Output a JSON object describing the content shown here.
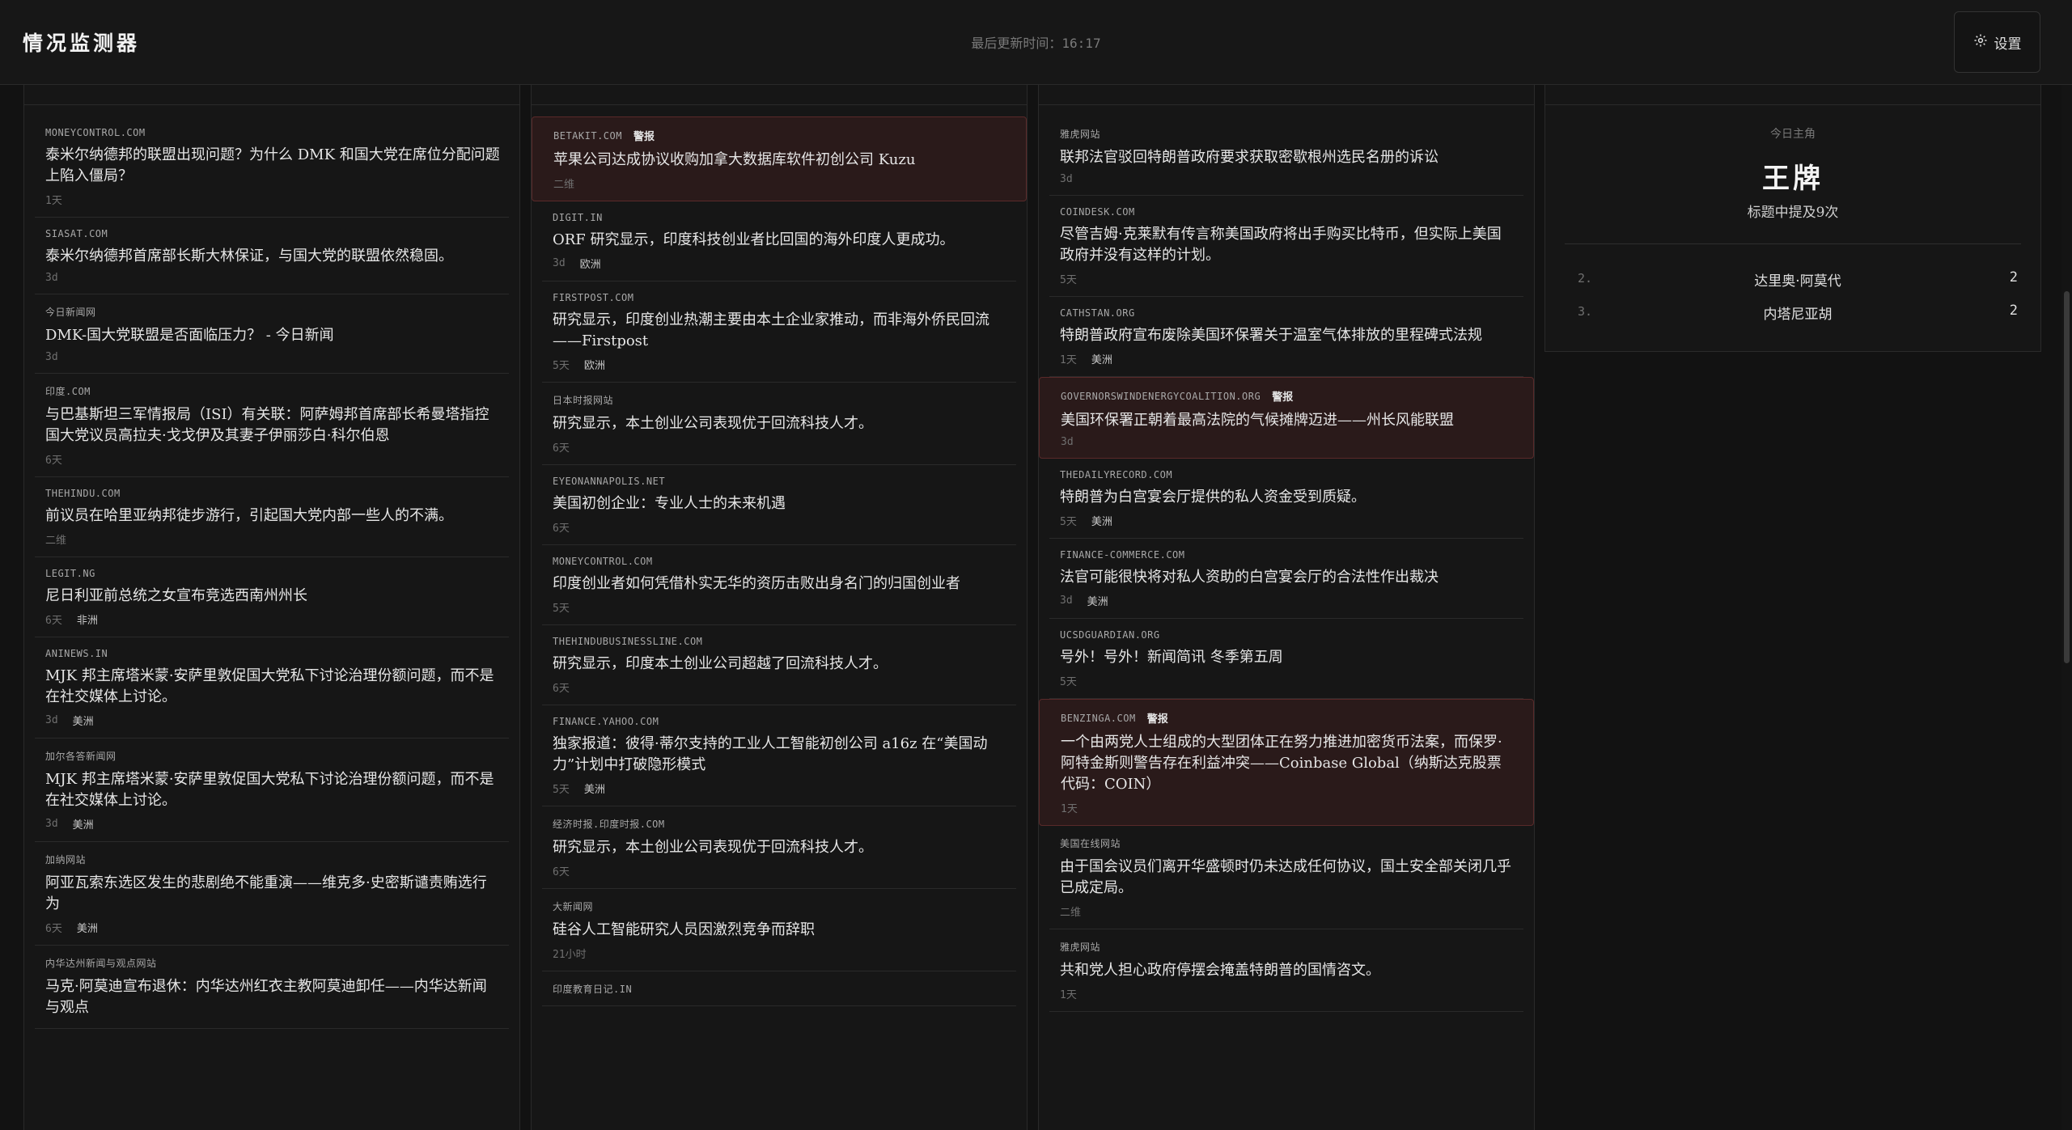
{
  "header": {
    "app_title": "情况监测器",
    "last_updated": "最后更新时间：16:17",
    "settings_label": "设置"
  },
  "columns": [
    {
      "heading": "",
      "items": [
        {
          "source": "MONEYCONTROL.COM",
          "headline": "泰米尔纳德邦的联盟出现问题？为什么 DMK 和国大党在席位分配问题上陷入僵局？",
          "age": "1天"
        },
        {
          "source": "SIASAT.COM",
          "headline": "泰米尔纳德邦首席部长斯大林保证，与国大党的联盟依然稳固。",
          "age": "3d"
        },
        {
          "source": "今日新闻网",
          "headline": "DMK-国大党联盟是否面临压力？ - 今日新闻",
          "age": "3d"
        },
        {
          "source": "印度.COM",
          "headline": "与巴基斯坦三军情报局（ISI）有关联：阿萨姆邦首席部长希曼塔指控国大党议员高拉夫·戈戈伊及其妻子伊丽莎白·科尔伯恩",
          "age": "6天"
        },
        {
          "source": "THEHINDU.COM",
          "headline": "前议员在哈里亚纳邦徒步游行，引起国大党内部一些人的不满。",
          "age": "二维"
        },
        {
          "source": "LEGIT.NG",
          "headline": "尼日利亚前总统之女宣布竞选西南州州长",
          "age": "6天",
          "region": "非洲"
        },
        {
          "source": "ANINEWS.IN",
          "headline": "MJK 邦主席塔米蒙·安萨里敦促国大党私下讨论治理份额问题，而不是在社交媒体上讨论。",
          "age": "3d",
          "region": "美洲"
        },
        {
          "source": "加尔各答新闻网",
          "headline": "MJK 邦主席塔米蒙·安萨里敦促国大党私下讨论治理份额问题，而不是在社交媒体上讨论。",
          "age": "3d",
          "region": "美洲"
        },
        {
          "source": "加纳网站",
          "headline": "阿亚瓦索东选区发生的悲剧绝不能重演——维克多·史密斯谴责贿选行为",
          "age": "6天",
          "region": "美洲"
        },
        {
          "source": "内华达州新闻与观点网站",
          "headline": "马克·阿莫迪宣布退休：内华达州红衣主教阿莫迪卸任——内华达新闻与观点",
          "age": ""
        }
      ]
    },
    {
      "heading": "",
      "items": [
        {
          "source": "BETAKIT.COM",
          "alert": true,
          "headline": "苹果公司达成协议收购加拿大数据库软件初创公司 Kuzu",
          "age": "二维"
        },
        {
          "source": "DIGIT.IN",
          "headline": "ORF 研究显示，印度科技创业者比回国的海外印度人更成功。",
          "age": "3d",
          "region": "欧洲"
        },
        {
          "source": "FIRSTPOST.COM",
          "headline": "研究显示，印度创业热潮主要由本土企业家推动，而非海外侨民回流——Firstpost",
          "age": "5天",
          "region": "欧洲"
        },
        {
          "source": "日本时报网站",
          "headline": "研究显示，本土创业公司表现优于回流科技人才。",
          "age": "6天"
        },
        {
          "source": "EYEONANNAPOLIS.NET",
          "headline": "美国初创企业：专业人士的未来机遇",
          "age": "6天"
        },
        {
          "source": "MONEYCONTROL.COM",
          "headline": "印度创业者如何凭借朴实无华的资历击败出身名门的归国创业者",
          "age": "5天"
        },
        {
          "source": "THEHINDUBUSINESSLINE.COM",
          "headline": "研究显示，印度本土创业公司超越了回流科技人才。",
          "age": "6天"
        },
        {
          "source": "FINANCE.YAHOO.COM",
          "headline": "独家报道：彼得·蒂尔支持的工业人工智能初创公司 a16z 在“美国动力”计划中打破隐形模式",
          "age": "5天",
          "region": "美洲"
        },
        {
          "source": "经济时报.印度时报.COM",
          "headline": "研究显示，本土创业公司表现优于回流科技人才。",
          "age": "6天"
        },
        {
          "source": "大新闻网",
          "headline": "硅谷人工智能研究人员因激烈竞争而辞职",
          "age": "21小时"
        },
        {
          "source": "印度教育日记.IN",
          "headline": "",
          "age": ""
        }
      ]
    },
    {
      "heading": "",
      "items": [
        {
          "source": "雅虎网站",
          "headline": "联邦法官驳回特朗普政府要求获取密歇根州选民名册的诉讼",
          "age": "3d"
        },
        {
          "source": "COINDESK.COM",
          "headline": "尽管吉姆·克莱默有传言称美国政府将出手购买比特币，但实际上美国政府并没有这样的计划。",
          "age": "5天"
        },
        {
          "source": "CATHSTAN.ORG",
          "headline": "特朗普政府宣布废除美国环保署关于温室气体排放的里程碑式法规",
          "age": "1天",
          "region": "美洲"
        },
        {
          "source": "GOVERNORSWINDENERGYCOALITION.ORG",
          "alert": true,
          "headline": "美国环保署正朝着最高法院的气候摊牌迈进——州长风能联盟",
          "age": "3d"
        },
        {
          "source": "THEDAILYRECORD.COM",
          "headline": "特朗普为白宫宴会厅提供的私人资金受到质疑。",
          "age": "5天",
          "region": "美洲"
        },
        {
          "source": "FINANCE-COMMERCE.COM",
          "headline": "法官可能很快将对私人资助的白宫宴会厅的合法性作出裁决",
          "age": "3d",
          "region": "美洲"
        },
        {
          "source": "UCSDGUARDIAN.ORG",
          "headline": "号外！号外！新闻简讯 冬季第五周",
          "age": "5天"
        },
        {
          "source": "BENZINGA.COM",
          "alert": true,
          "headline": "一个由两党人士组成的大型团体正在努力推进加密货币法案，而保罗·阿特金斯则警告存在利益冲突——Coinbase Global（纳斯达克股票代码：COIN）",
          "age": "1天"
        },
        {
          "source": "美国在线网站",
          "headline": "由于国会议员们离开华盛顿时仍未达成任何协议，国土安全部关闭几乎已成定局。",
          "age": "二维"
        },
        {
          "source": "雅虎网站",
          "headline": "共和党人担心政府停摆会掩盖特朗普的国情咨文。",
          "age": "1天"
        }
      ]
    }
  ],
  "alert_label": "警报",
  "protagonist": {
    "label": "今日主角",
    "name": "王牌",
    "mentions": "标题中提及9次",
    "ranking": [
      {
        "rank": "2.",
        "name": "达里奥·阿莫代",
        "count": "2"
      },
      {
        "rank": "3.",
        "name": "内塔尼亚胡",
        "count": "2"
      }
    ]
  },
  "colors": {
    "background": "#121212",
    "panel": "#161616",
    "alert_bg": "#2a1a1a",
    "alert_border": "#5a2a2a",
    "text": "#e6e6e6",
    "muted": "#6f6f6f"
  },
  "icons": {
    "settings": "gear-icon"
  }
}
